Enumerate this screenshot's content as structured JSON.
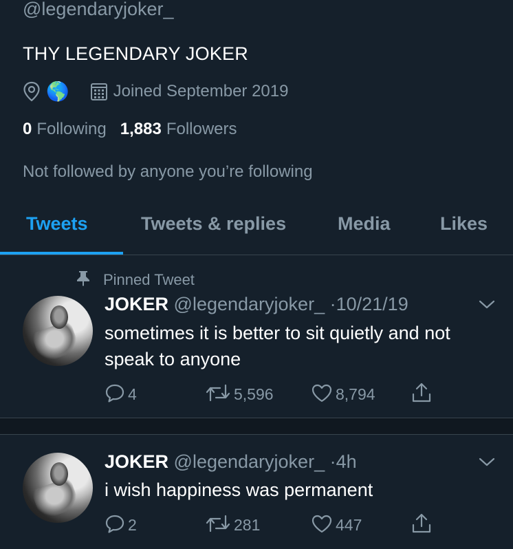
{
  "profile": {
    "handle": "@legendaryjoker_",
    "bio": "THY LEGENDARY JOKER",
    "location_icon": "location-pin-icon",
    "location_emoji": "🌎",
    "joined": "Joined September 2019",
    "following_count": "0",
    "following_label": "Following",
    "followers_count": "1,883",
    "followers_label": "Followers",
    "not_followed": "Not followed by anyone you’re following"
  },
  "tabs": [
    {
      "label": "Tweets",
      "active": true
    },
    {
      "label": "Tweets & replies",
      "active": false
    },
    {
      "label": "Media",
      "active": false
    },
    {
      "label": "Likes",
      "active": false
    }
  ],
  "tweets": [
    {
      "pinned_label": "Pinned Tweet",
      "name": "JOKER",
      "username": "@legendaryjoker_",
      "separator": "·",
      "time": "10/21/19",
      "text": "sometimes it is better to sit quietly and not speak to anyone",
      "replies": "4",
      "retweets": "5,596",
      "likes": "8,794"
    },
    {
      "name": "JOKER",
      "username": "@legendaryjoker_",
      "separator": "·",
      "time": "4h",
      "text": "i wish happiness was permanent",
      "replies": "2",
      "retweets": "281",
      "likes": "447"
    }
  ],
  "colors": {
    "background": "#15202b",
    "accent": "#1da1f2",
    "secondary_text": "#8899a6",
    "divider": "#38444d"
  }
}
